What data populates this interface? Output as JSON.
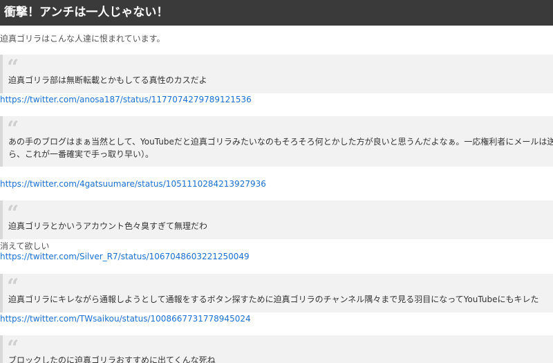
{
  "header": {
    "title": "衝撃！アンチは一人じゃない！"
  },
  "intro": "迫真ゴリラはこんな人達に恨まれています。",
  "quote_icon": "quote-mark-icon",
  "quotes": [
    {
      "lines": [
        "迫真ゴリラ部は無断転載とかもしてる真性のカスだよ"
      ]
    },
    {
      "lines": [
        "あの手のブログはまぁ当然として、YouTubeだと迫真ゴリラみたいなのもそろそろ何とかした方が良いと思うんだよなぁ。一応権利者にメールは送っといたけど（",
        "ら、これが一番確実で手っ取り早い）。"
      ]
    },
    {
      "lines": [
        "迫真ゴリラとかいうアカウント色々臭すぎて無理だわ"
      ]
    },
    {
      "lines": [
        "迫真ゴリラにキレながら通報しようとして通報をするボタン探すために迫真ゴリラのチャンネル隅々まで見る羽目になってYouTubeにもキレた"
      ]
    },
    {
      "lines": [
        "ブロックしたのに迫真ゴリラおすすめに出てくんな死ね"
      ]
    }
  ],
  "links": [
    "https://twitter.com/anosa187/status/1177074279789121536",
    "https://twitter.com/4gatsuumare/status/1051110284213927936",
    "https://twitter.com/Silver_R7/status/1067048603221250049",
    "https://twitter.com/TWsaikou/status/1008667731778945024"
  ],
  "extra_text": "消えて欲しい"
}
